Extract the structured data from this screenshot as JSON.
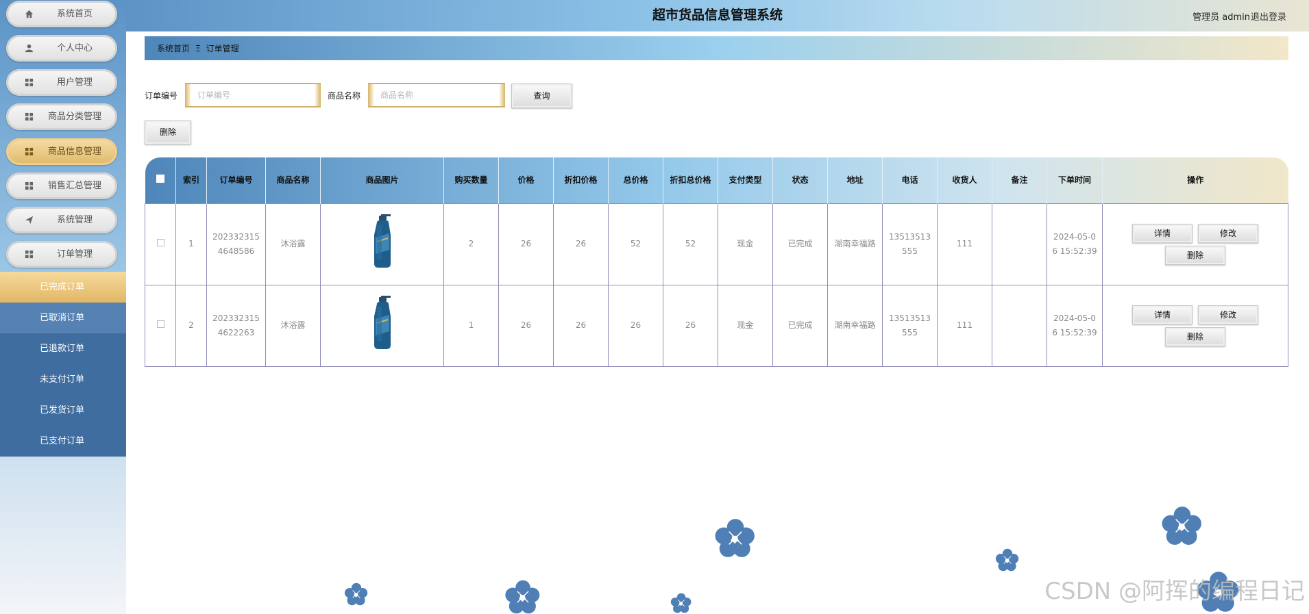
{
  "header": {
    "title": "超市货品信息管理系统",
    "user": "管理员 admin",
    "logout": "退出登录"
  },
  "sidebar": {
    "items": [
      {
        "label": "系统首页",
        "icon": "home-icon",
        "active": false
      },
      {
        "label": "个人中心",
        "icon": "user-icon",
        "active": false
      },
      {
        "label": "用户管理",
        "icon": "grid-icon",
        "active": false
      },
      {
        "label": "商品分类管理",
        "icon": "grid-icon",
        "active": false
      },
      {
        "label": "商品信息管理",
        "icon": "grid-icon",
        "active": true
      },
      {
        "label": "销售汇总管理",
        "icon": "grid-icon",
        "active": false
      },
      {
        "label": "系统管理",
        "icon": "send-icon",
        "active": false
      },
      {
        "label": "订单管理",
        "icon": "grid-icon",
        "active": false
      }
    ],
    "sub_items": [
      "已完成订单",
      "已取消订单",
      "已退款订单",
      "未支付订单",
      "已发货订单",
      "已支付订单"
    ]
  },
  "breadcrumb": {
    "home": "系统首页",
    "separator": "Ξ",
    "current": "订单管理"
  },
  "search": {
    "order_label": "订单编号",
    "order_placeholder": "订单编号",
    "product_label": "商品名称",
    "product_placeholder": "商品名称",
    "query_button": "查询",
    "delete_button": "删除"
  },
  "table": {
    "headers": [
      "索引",
      "订单编号",
      "商品名称",
      "商品图片",
      "购买数量",
      "价格",
      "折扣价格",
      "总价格",
      "折扣总价格",
      "支付类型",
      "状态",
      "地址",
      "电话",
      "收货人",
      "备注",
      "下单时间",
      "操作"
    ],
    "rows": [
      {
        "index": "1",
        "order_no": "2023323154648586",
        "name": "沐浴露",
        "qty": "2",
        "price": "26",
        "discount_price": "26",
        "total": "52",
        "discount_total": "52",
        "pay_type": "现金",
        "status": "已完成",
        "address": "湖南幸福路",
        "phone": "13513513555",
        "receiver": "111",
        "note": "",
        "time": "2024-05-06 15:52:39"
      },
      {
        "index": "2",
        "order_no": "2023323154622263",
        "name": "沐浴露",
        "qty": "1",
        "price": "26",
        "discount_price": "26",
        "total": "26",
        "discount_total": "26",
        "pay_type": "现金",
        "status": "已完成",
        "address": "湖南幸福路",
        "phone": "13513513555",
        "receiver": "111",
        "note": "",
        "time": "2024-05-06 15:52:39"
      }
    ],
    "actions": {
      "detail": "详情",
      "edit": "修改",
      "delete": "删除"
    }
  },
  "watermark": "CSDN @阿挥的编程日记",
  "colors": {
    "sidebar_dark": "#3f6da0",
    "accent_gold": "#e2b767",
    "header_blue": "#8ec3e8",
    "flower": "#4f7fb4"
  }
}
